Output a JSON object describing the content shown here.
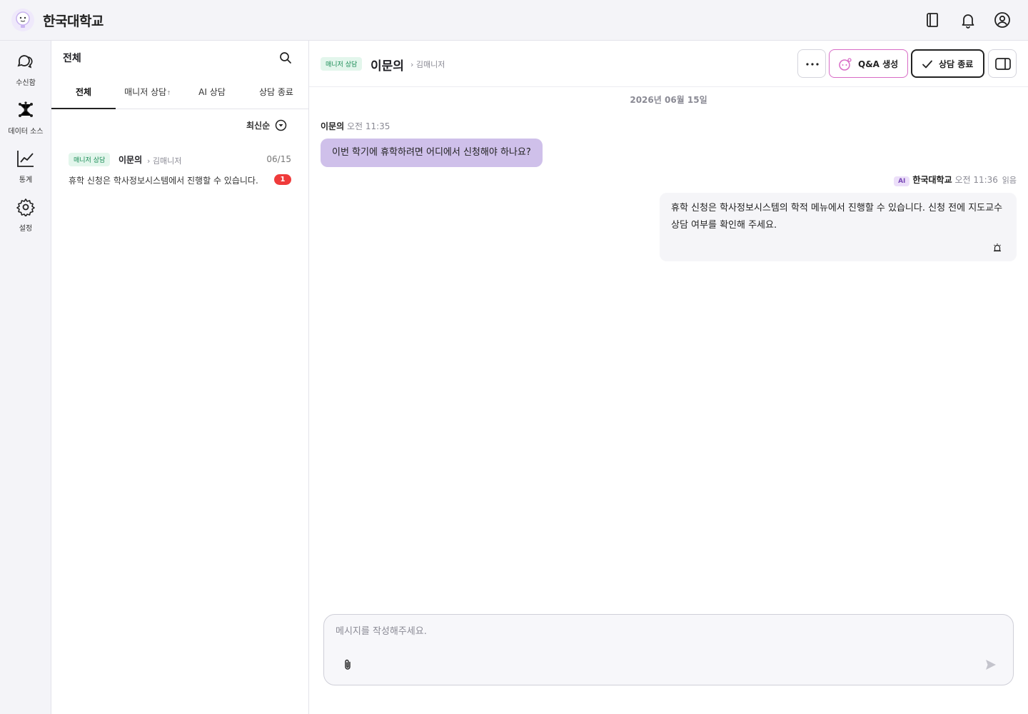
{
  "app": {
    "brand": "한국대학교"
  },
  "topbar": {
    "icons": [
      "book-icon",
      "bell-icon",
      "user-icon"
    ]
  },
  "nav": {
    "items": [
      {
        "label": "수신함",
        "icon": "inbox-chat-icon"
      },
      {
        "label": "데이터 소스",
        "icon": "nodes-icon"
      },
      {
        "label": "통계",
        "icon": "chart-line-icon"
      },
      {
        "label": "설정",
        "icon": "gear-icon"
      }
    ]
  },
  "list": {
    "title": "전체",
    "tabs": [
      {
        "label": "전체",
        "active": true
      },
      {
        "label": "매니저 상담",
        "sort_mark": "↑"
      },
      {
        "label": "AI 상담"
      },
      {
        "label": "상담 종료"
      }
    ],
    "sort_label": "최신순",
    "conversations": [
      {
        "badge": "매니저 상담",
        "name": "이문의",
        "manager": "김매니저",
        "date": "06/15",
        "preview": "휴학 신청은 학사정보시스템에서 진행할 수 있습니다.",
        "unread": "1"
      }
    ]
  },
  "chat": {
    "badge": "매니저 상담",
    "name": "이문의",
    "manager": "김매니저",
    "buttons": {
      "qa": "Q&A 생성",
      "end": "상담 종료"
    },
    "date_separator": "2026년 06월 15일",
    "messages": [
      {
        "sender": "이문의",
        "time": "오전 11:35",
        "text": "이번 학기에 휴학하려면 어디에서 신청해야 하나요?"
      },
      {
        "ai_badge": "AI",
        "sender": "한국대학교",
        "time": "오전 11:36",
        "status": "읽음",
        "text": "휴학 신청은 학사정보시스템의 학적 메뉴에서 진행할 수 있습니다. 신청 전에 지도교수 상담 여부를 확인해 주세요."
      }
    ],
    "composer": {
      "placeholder": "메시지를 작성해주세요.",
      "value": ""
    }
  },
  "colors": {
    "accent_purple": "#cfc0ea",
    "unread_red": "#ef3b3b",
    "manager_badge_bg": "#e3f6ec",
    "manager_badge_text": "#1a8c56",
    "qa_border": "#d86bc6"
  }
}
